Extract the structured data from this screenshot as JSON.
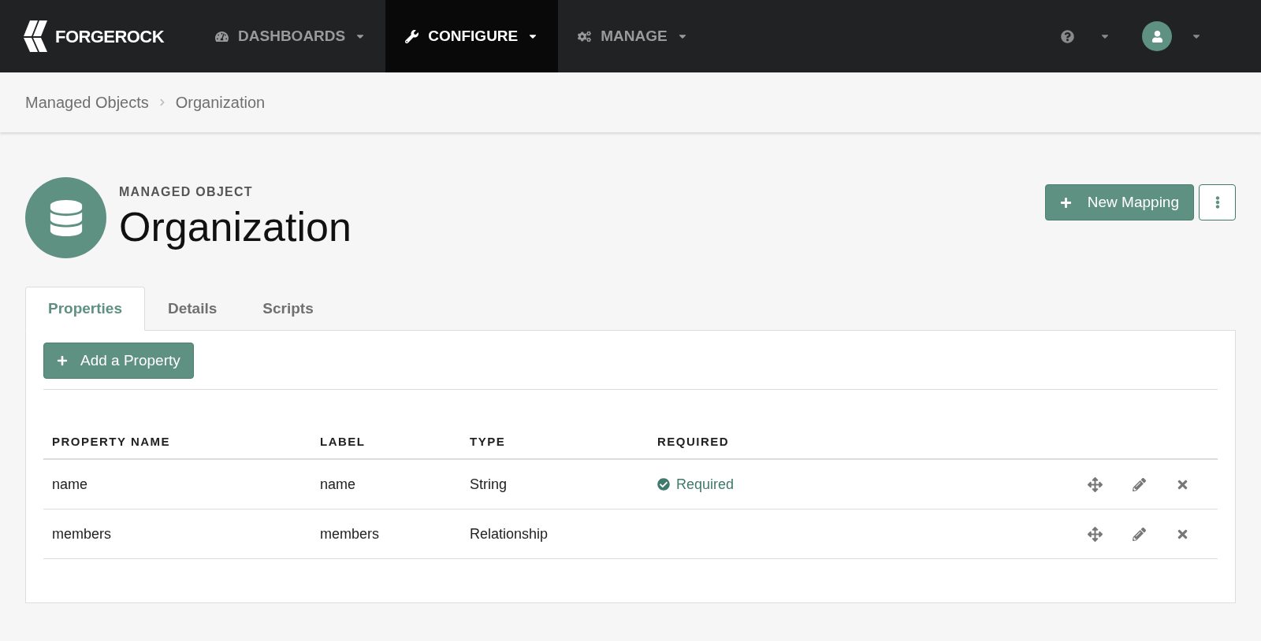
{
  "logo": {
    "text": "FORGEROCK"
  },
  "nav": [
    {
      "label": "DASHBOARDS",
      "kind": "dashboards",
      "selected": false
    },
    {
      "label": "CONFIGURE",
      "kind": "configure",
      "selected": true
    },
    {
      "label": "MANAGE",
      "kind": "manage",
      "selected": false
    }
  ],
  "breadcrumbs": [
    "Managed Objects",
    "Organization"
  ],
  "header": {
    "eyebrow": "MANAGED OBJECT",
    "title": "Organization",
    "primary_button": "New Mapping"
  },
  "tabs": [
    {
      "label": "Properties",
      "selected": true
    },
    {
      "label": "Details",
      "selected": false
    },
    {
      "label": "Scripts",
      "selected": false
    }
  ],
  "add_button": "Add a Property",
  "table": {
    "columns": [
      "PROPERTY NAME",
      "LABEL",
      "TYPE",
      "REQUIRED"
    ],
    "rows": [
      {
        "name": "name",
        "label": "name",
        "type": "String",
        "required": true,
        "required_text": "Required"
      },
      {
        "name": "members",
        "label": "members",
        "type": "Relationship",
        "required": false
      }
    ]
  }
}
